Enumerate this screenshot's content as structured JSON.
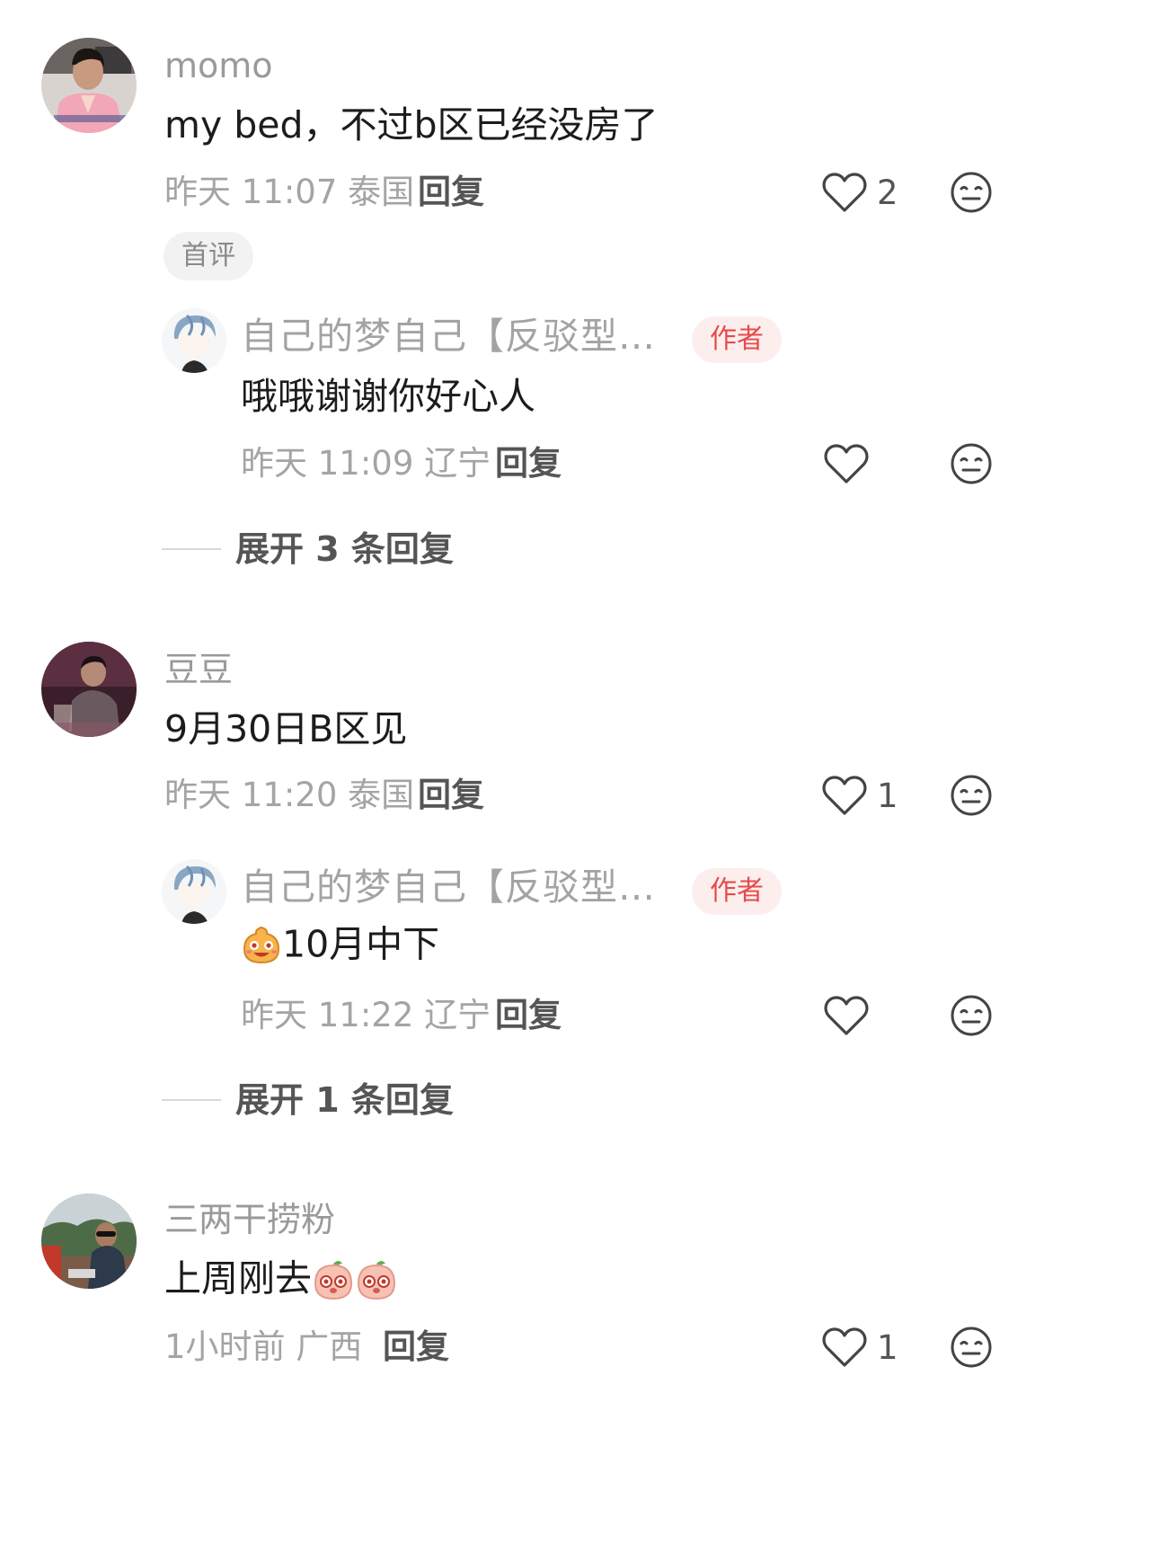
{
  "comments": [
    {
      "username": "momo",
      "avatar_icon": "avatar-woman-pink-jacket",
      "text": "my bed，不过b区已经没房了",
      "time": "昨天 11:07 泰国",
      "reply_label": "回复",
      "likes": "2",
      "badge": "首评",
      "replies": [
        {
          "username": "自己的梦自己【反驳型…",
          "avatar_icon": "avatar-anime-boy",
          "badge": "作者",
          "text": "哦哦谢谢你好心人",
          "time": "昨天 11:09 辽宁",
          "reply_label": "回复",
          "likes": ""
        }
      ],
      "expand_label": "展开 3 条回复"
    },
    {
      "username": "豆豆",
      "avatar_icon": "avatar-man-dark-room",
      "text": "9月30日B区见",
      "time": "昨天 11:20 泰国",
      "reply_label": "回复",
      "likes": "1",
      "replies": [
        {
          "username": "自己的梦自己【反驳型…",
          "avatar_icon": "avatar-anime-boy",
          "badge": "作者",
          "emoji_prefix": "smiling-blob-emoji",
          "text": "10月中下",
          "time": "昨天 11:22 辽宁",
          "reply_label": "回复",
          "likes": ""
        }
      ],
      "expand_label": "展开 1 条回复"
    },
    {
      "username": "三两干捞粉",
      "avatar_icon": "avatar-man-sunglasses",
      "text": "上周刚去",
      "emoji_suffix": [
        "peach-face-emoji",
        "peach-face-emoji"
      ],
      "time": "1小时前 广西",
      "reply_label": "回复",
      "likes": "1"
    }
  ],
  "icons": {
    "like": "heart-outline-icon",
    "dislike": "neutral-face-icon"
  },
  "colors": {
    "username": "#9a9a9a",
    "content": "#1c1c1c",
    "meta": "#a4a4a4",
    "author_badge_bg": "#fdeeee",
    "author_badge_text": "#e64b4b",
    "first_badge_bg": "#f2f2f2"
  }
}
